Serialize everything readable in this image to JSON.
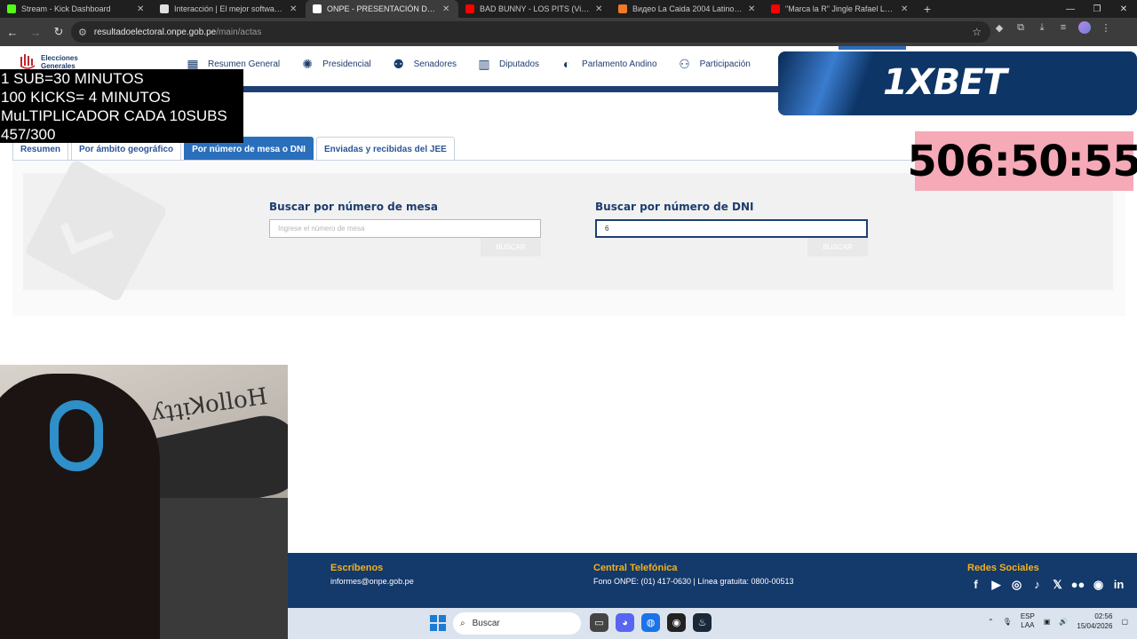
{
  "browser": {
    "tabs": [
      {
        "title": "Stream - Kick Dashboard",
        "favicon_color": "#53fc18",
        "active": false
      },
      {
        "title": "Interacción | El mejor software p",
        "favicon_color": "#e0e0e0",
        "active": false
      },
      {
        "title": "ONPE - PRESENTACIÓN DE RES",
        "favicon_color": "#ffffff",
        "active": true
      },
      {
        "title": "BAD BUNNY - LOS PITS (Visual",
        "favicon_color": "#ff0000",
        "active": false
      },
      {
        "title": "Видео La Caida 2004 Latino (D",
        "favicon_color": "#f07a26",
        "active": false
      },
      {
        "title": "\"Marca la R\" Jingle Rafael López",
        "favicon_color": "#ff0000",
        "active": false
      }
    ],
    "close_glyph": "✕",
    "new_tab_glyph": "+",
    "url_host": "resultadoelectoral.onpe.gob.pe",
    "url_path": "/main/actas"
  },
  "site": {
    "logo_text": [
      "Elecciones",
      "Generales"
    ],
    "nav": [
      {
        "label": "Resumen General",
        "icon": "chart-icon",
        "glyph": "▦"
      },
      {
        "label": "Presidencial",
        "icon": "seal-icon",
        "glyph": "✺"
      },
      {
        "label": "Senadores",
        "icon": "people-icon",
        "glyph": "⚉"
      },
      {
        "label": "Diputados",
        "icon": "building-icon",
        "glyph": "▥"
      },
      {
        "label": "Parlamento Andino",
        "icon": "globe-icon",
        "glyph": "◐"
      },
      {
        "label": "Participación",
        "icon": "group-icon",
        "glyph": "⚇"
      }
    ],
    "subtabs": [
      {
        "label": "Resumen",
        "active": false
      },
      {
        "label": "Por ámbito geográfico",
        "active": false
      },
      {
        "label": "Por número de mesa o DNI",
        "active": true
      },
      {
        "label": "Enviadas y recibidas del JEE",
        "active": false
      }
    ],
    "search_mesa": {
      "label": "Buscar por número de mesa",
      "placeholder": "Ingrese el número de mesa",
      "value": "",
      "button": "BUSCAR"
    },
    "search_dni": {
      "label": "Buscar por número de DNI",
      "placeholder": "",
      "value": "6",
      "button": "BUSCAR"
    }
  },
  "overlay": {
    "lines": [
      "1 SUB=30 MINUTOS",
      "100 KICKS= 4 MINUTOS",
      "MuLTIPLICADOR CADA 10SUBS",
      "457/300"
    ],
    "ad_brand": "1XBET",
    "timer": "506:50:55"
  },
  "cam": {
    "sticker": "Hello Kitty"
  },
  "footer": {
    "write_title": "Escríbenos",
    "write_email": "informes@onpe.gob.pe",
    "phone_title": "Central Telefónica",
    "phone_text": "Fono ONPE: (01) 417-0630 | Línea gratuita: 0800-00513",
    "social_title": "Redes Sociales",
    "social": [
      {
        "icon": "facebook-icon",
        "glyph": "f"
      },
      {
        "icon": "youtube-icon",
        "glyph": "▶"
      },
      {
        "icon": "instagram-icon",
        "glyph": "◎"
      },
      {
        "icon": "tiktok-icon",
        "glyph": "♪"
      },
      {
        "icon": "x-icon",
        "glyph": "𝕏"
      },
      {
        "icon": "flickr-icon",
        "glyph": "●●"
      },
      {
        "icon": "spotify-icon",
        "glyph": "◉"
      },
      {
        "icon": "linkedin-icon",
        "glyph": "in"
      }
    ]
  },
  "taskbar": {
    "search_label": "Buscar",
    "lang_top": "ESP",
    "lang_bottom": "LAA",
    "time": "02:56",
    "date": "15/04/2026"
  }
}
